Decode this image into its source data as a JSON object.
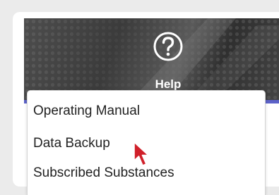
{
  "header": {
    "help_label": "Help",
    "help_icon": "question-circle-icon"
  },
  "menu": {
    "items": [
      {
        "label": "Operating Manual"
      },
      {
        "label": "Data Backup"
      },
      {
        "label": "Subscribed Substances"
      }
    ]
  },
  "colors": {
    "active_bar": "#5c62c8",
    "header_bg": "#444444",
    "cursor": "#d0202a"
  }
}
